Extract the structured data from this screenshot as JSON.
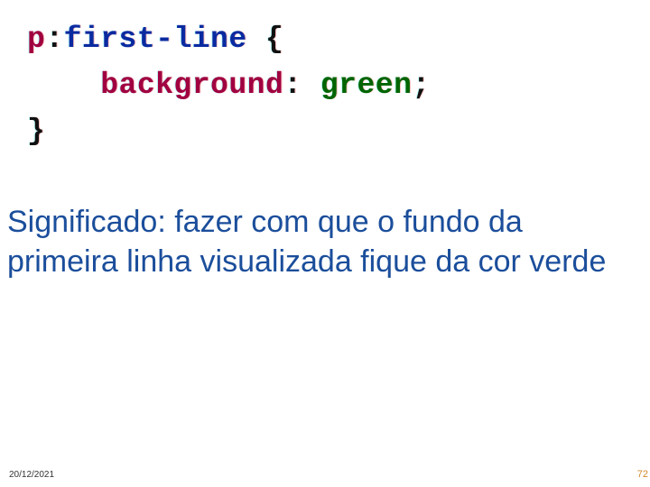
{
  "code": {
    "selector": "p",
    "colon": ":",
    "pseudo": "first-line",
    "brace_open": " {",
    "indent": "    ",
    "property": "background",
    "prop_colon": ": ",
    "value": "green",
    "semicolon": ";",
    "brace_close": "}"
  },
  "paragraph": "Significado: fazer com que o fundo da primeira linha visualizada fique da cor verde",
  "footer": {
    "date": "20/12/2021",
    "page": "72"
  }
}
